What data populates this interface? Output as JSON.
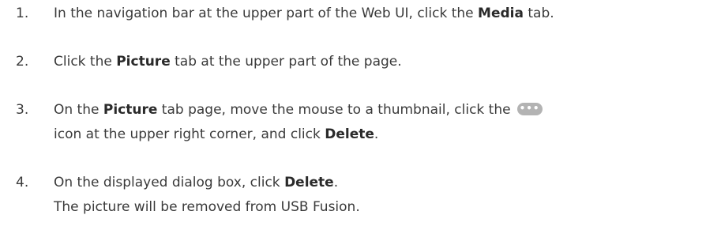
{
  "steps": [
    {
      "number": "1.",
      "a": "In the navigation bar at the upper part of the Web UI, click the ",
      "b": "Media",
      "c": " tab."
    },
    {
      "number": "2.",
      "a": "Click the ",
      "b": "Picture",
      "c": " tab at the upper part of the page."
    },
    {
      "number": "3.",
      "a": "On the ",
      "b": "Picture",
      "c": " tab page, move the mouse to a thumbnail, click the",
      "icon": "more-icon",
      "icon_text": "•••",
      "d": "icon at the upper right corner, and click ",
      "e": "Delete",
      "f": "."
    },
    {
      "number": "4.",
      "a": "On the displayed dialog box, click ",
      "b": "Delete",
      "c": ".",
      "d": "The picture will be removed from USB Fusion."
    }
  ]
}
